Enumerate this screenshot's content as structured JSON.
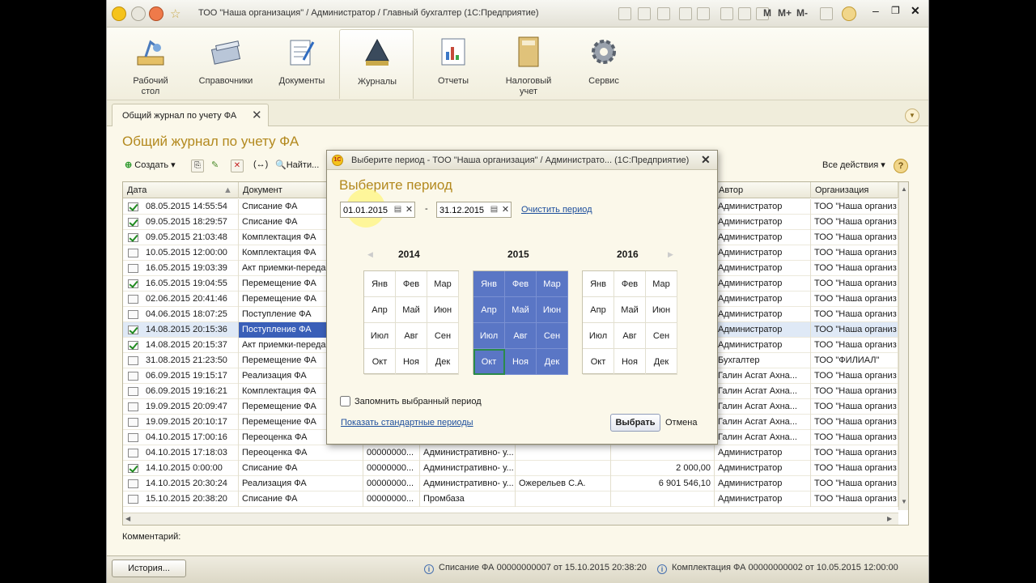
{
  "window": {
    "title": "ТОО \"Наша организация\" / Администратор / Главный бухгалтер  (1С:Предприятие)"
  },
  "quick_access": {
    "m": "M",
    "mplus": "M+",
    "mminus": "M-"
  },
  "ribbon": [
    {
      "name": "Рабочий\nстол",
      "l1": "Рабочий",
      "l2": "стол"
    },
    {
      "l1": "Справочники",
      "l2": ""
    },
    {
      "l1": "Документы",
      "l2": ""
    },
    {
      "l1": "Журналы",
      "l2": ""
    },
    {
      "l1": "Отчеты",
      "l2": ""
    },
    {
      "l1": "Налоговый",
      "l2": "учет"
    },
    {
      "l1": "Сервис",
      "l2": ""
    }
  ],
  "tab": {
    "label": "Общий журнал по учету ФА"
  },
  "page": {
    "title": "Общий журнал по учету ФА"
  },
  "toolbar": {
    "create": "Создать",
    "find": "Найти...",
    "all_actions": "Все действия",
    "help": "?"
  },
  "grid": {
    "headers": {
      "date": "Дата",
      "doc": "Документ",
      "author": "Автор",
      "org": "Организация"
    },
    "rows": [
      {
        "date": "08.05.2015 14:55:54",
        "doc": "Списание ФА",
        "num": "",
        "sub": "",
        "mol": "",
        "sum": "",
        "author": "Администратор",
        "org": "ТОО \"Наша организ",
        "posted": true
      },
      {
        "date": "09.05.2015 18:29:57",
        "doc": "Списание ФА",
        "num": "",
        "sub": "",
        "mol": "",
        "sum": "",
        "author": "Администратор",
        "org": "ТОО \"Наша организ",
        "posted": true
      },
      {
        "date": "09.05.2015 21:03:48",
        "doc": "Комплектация ФА",
        "num": "",
        "sub": "",
        "mol": "",
        "sum": "",
        "author": "Администратор",
        "org": "ТОО \"Наша организ",
        "posted": true
      },
      {
        "date": "10.05.2015 12:00:00",
        "doc": "Комплектация ФА",
        "num": "",
        "sub": "",
        "mol": "",
        "sum": "",
        "author": "Администратор",
        "org": "ТОО \"Наша организ",
        "posted": false
      },
      {
        "date": "16.05.2015 19:03:39",
        "doc": "Акт приемки-переда",
        "num": "",
        "sub": "",
        "mol": "",
        "sum": "",
        "author": "Администратор",
        "org": "ТОО \"Наша организ",
        "posted": false
      },
      {
        "date": "16.05.2015 19:04:55",
        "doc": "Перемещение ФА",
        "num": "",
        "sub": "",
        "mol": "",
        "sum": "",
        "author": "Администратор",
        "org": "ТОО \"Наша организ",
        "posted": true
      },
      {
        "date": "02.06.2015 20:41:46",
        "doc": "Перемещение ФА",
        "num": "",
        "sub": "",
        "mol": "",
        "sum": "",
        "author": "Администратор",
        "org": "ТОО \"Наша организ",
        "posted": false
      },
      {
        "date": "04.06.2015 18:07:25",
        "doc": "Поступление ФА",
        "num": "",
        "sub": "",
        "mol": "",
        "sum": "",
        "author": "Администратор",
        "org": "ТОО \"Наша организ",
        "posted": false
      },
      {
        "date": "14.08.2015 20:15:36",
        "doc": "Поступление ФА",
        "num": "",
        "sub": "",
        "mol": "",
        "sum": "",
        "author": "Администратор",
        "org": "ТОО \"Наша организ",
        "posted": true,
        "selected": true
      },
      {
        "date": "14.08.2015 20:15:37",
        "doc": "Акт приемки-переда",
        "num": "",
        "sub": "",
        "mol": "",
        "sum": "",
        "author": "Администратор",
        "org": "ТОО \"Наша организ",
        "posted": true
      },
      {
        "date": "31.08.2015 21:23:50",
        "doc": "Перемещение ФА",
        "num": "",
        "sub": "",
        "mol": "",
        "sum": "",
        "author": "Бухгалтер",
        "org": "ТОО \"ФИЛИАЛ\"",
        "posted": false
      },
      {
        "date": "06.09.2015 19:15:17",
        "doc": "Реализация ФА",
        "num": "",
        "sub": "",
        "mol": "",
        "sum": "",
        "author": "Галин Асгат Ахна...",
        "org": "ТОО \"Наша организ",
        "posted": false
      },
      {
        "date": "06.09.2015 19:16:21",
        "doc": "Комплектация ФА",
        "num": "",
        "sub": "",
        "mol": "",
        "sum": "",
        "author": "Галин Асгат Ахна...",
        "org": "ТОО \"Наша организ",
        "posted": false
      },
      {
        "date": "19.09.2015 20:09:47",
        "doc": "Перемещение ФА",
        "num": "",
        "sub": "",
        "mol": "",
        "sum": "",
        "author": "Галин Асгат Ахна...",
        "org": "ТОО \"Наша организ",
        "posted": false
      },
      {
        "date": "19.09.2015 20:10:17",
        "doc": "Перемещение ФА",
        "num": "",
        "sub": "",
        "mol": "",
        "sum": "",
        "author": "Галин Асгат Ахна...",
        "org": "ТОО \"Наша организ",
        "posted": false
      },
      {
        "date": "04.10.2015 17:00:16",
        "doc": "Переоценка ФА",
        "num": "",
        "sub": "",
        "mol": "",
        "sum": "",
        "author": "Галин Асгат Ахна...",
        "org": "ТОО \"Наша организ",
        "posted": false
      },
      {
        "date": "04.10.2015 17:18:03",
        "doc": "Переоценка ФА",
        "num": "00000000...",
        "sub": "Административно- у...",
        "mol": "",
        "sum": "",
        "author": "Администратор",
        "org": "ТОО \"Наша организ",
        "posted": false
      },
      {
        "date": "14.10.2015 0:00:00",
        "doc": "Списание ФА",
        "num": "00000000...",
        "sub": "Административно- у...",
        "mol": "",
        "sum": "2 000,00",
        "author": "Администратор",
        "org": "ТОО \"Наша организ",
        "posted": true
      },
      {
        "date": "14.10.2015 20:30:24",
        "doc": "Реализация ФА",
        "num": "00000000...",
        "sub": "Административно- у...",
        "mol": "Ожерельев С.А.",
        "sum": "6 901 546,10",
        "author": "Администратор",
        "org": "ТОО \"Наша организ",
        "posted": false
      },
      {
        "date": "15.10.2015 20:38:20",
        "doc": "Списание ФА",
        "num": "00000000...",
        "sub": "Промбаза",
        "mol": "",
        "sum": "",
        "author": "Администратор",
        "org": "ТОО \"Наша организ",
        "posted": false
      }
    ]
  },
  "comment": {
    "label": "Комментарий:"
  },
  "bottom": {
    "history": "История...",
    "status1": "Списание ФА 00000000007 от 15.10.2015 20:38:20",
    "status2": "Комплектация ФА 00000000002 от 10.05.2015 12:00:00"
  },
  "modal": {
    "title": "Выберите период - ТОО \"Наша организация\" / Администрато...  (1С:Предприятие)",
    "heading": "Выберите период",
    "date_from": "01.01.2015",
    "date_to": "31.12.2015",
    "dash": "-",
    "clear": "Очистить период",
    "years": [
      "2014",
      "2015",
      "2016"
    ],
    "months": [
      "Янв",
      "Фев",
      "Мар",
      "Апр",
      "Май",
      "Июн",
      "Июл",
      "Авг",
      "Сен",
      "Окт",
      "Ноя",
      "Дек"
    ],
    "remember": "Запомнить выбранный период",
    "std_periods": "Показать стандартные периоды",
    "ok": "Выбрать",
    "cancel": "Отмена"
  },
  "colors": {
    "accent_title": "#b3891e",
    "selected_month": "#5a76c5",
    "link": "#1d4e9c"
  }
}
